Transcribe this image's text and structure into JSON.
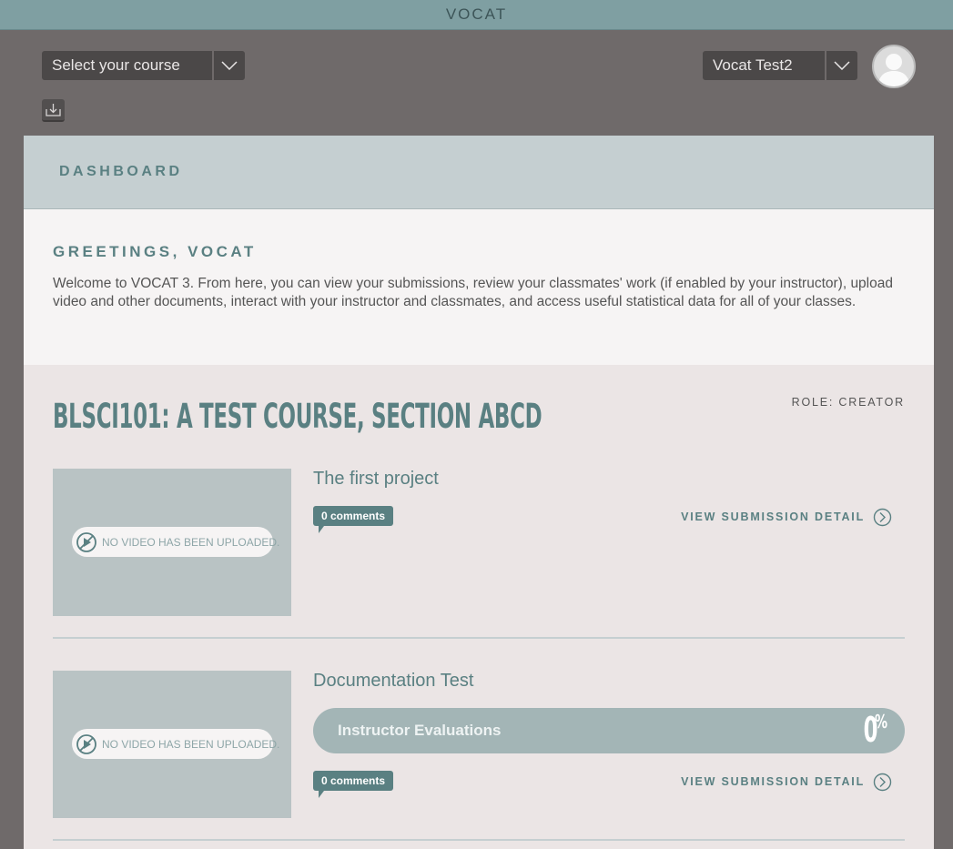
{
  "app": {
    "logo": "VOCAT"
  },
  "header": {
    "course_select": {
      "label": "Select your course"
    },
    "user_select": {
      "label": "Vocat Test2"
    }
  },
  "dashboard": {
    "title": "DASHBOARD",
    "greeting_title": "GREETINGS, VOCAT",
    "greeting_text": "Welcome to VOCAT 3. From here, you can view your submissions, review your classmates' work (if enabled by your instructor), upload video and other documents, interact with your instructor and classmates, and access useful statistical data for all of your classes."
  },
  "course": {
    "title": "BLSCI101: A TEST COURSE, SECTION ABCD",
    "role": "ROLE: CREATOR"
  },
  "projects": [
    {
      "title": "The first project",
      "no_video_text": "NO VIDEO HAS BEEN UPLOADED.",
      "comments": "0 comments",
      "view_detail": "VIEW SUBMISSION DETAIL"
    },
    {
      "title": "Documentation Test",
      "no_video_text": "NO VIDEO HAS BEEN UPLOADED.",
      "evaluation": {
        "label": "Instructor Evaluations",
        "value": "0",
        "unit": "%"
      },
      "comments": "0 comments",
      "view_detail": "VIEW SUBMISSION DETAIL"
    }
  ],
  "colors": {
    "topbar": "#7f9fa2",
    "header": "#6f6a6a",
    "accent": "#5a8082",
    "panel": "#ebe5e5"
  },
  "icons": {
    "dropdown": "chevron-down-icon",
    "avatar": "user-avatar-icon",
    "download": "download-icon",
    "no_video": "no-video-icon",
    "view_detail": "arrow-right-circle-icon"
  }
}
